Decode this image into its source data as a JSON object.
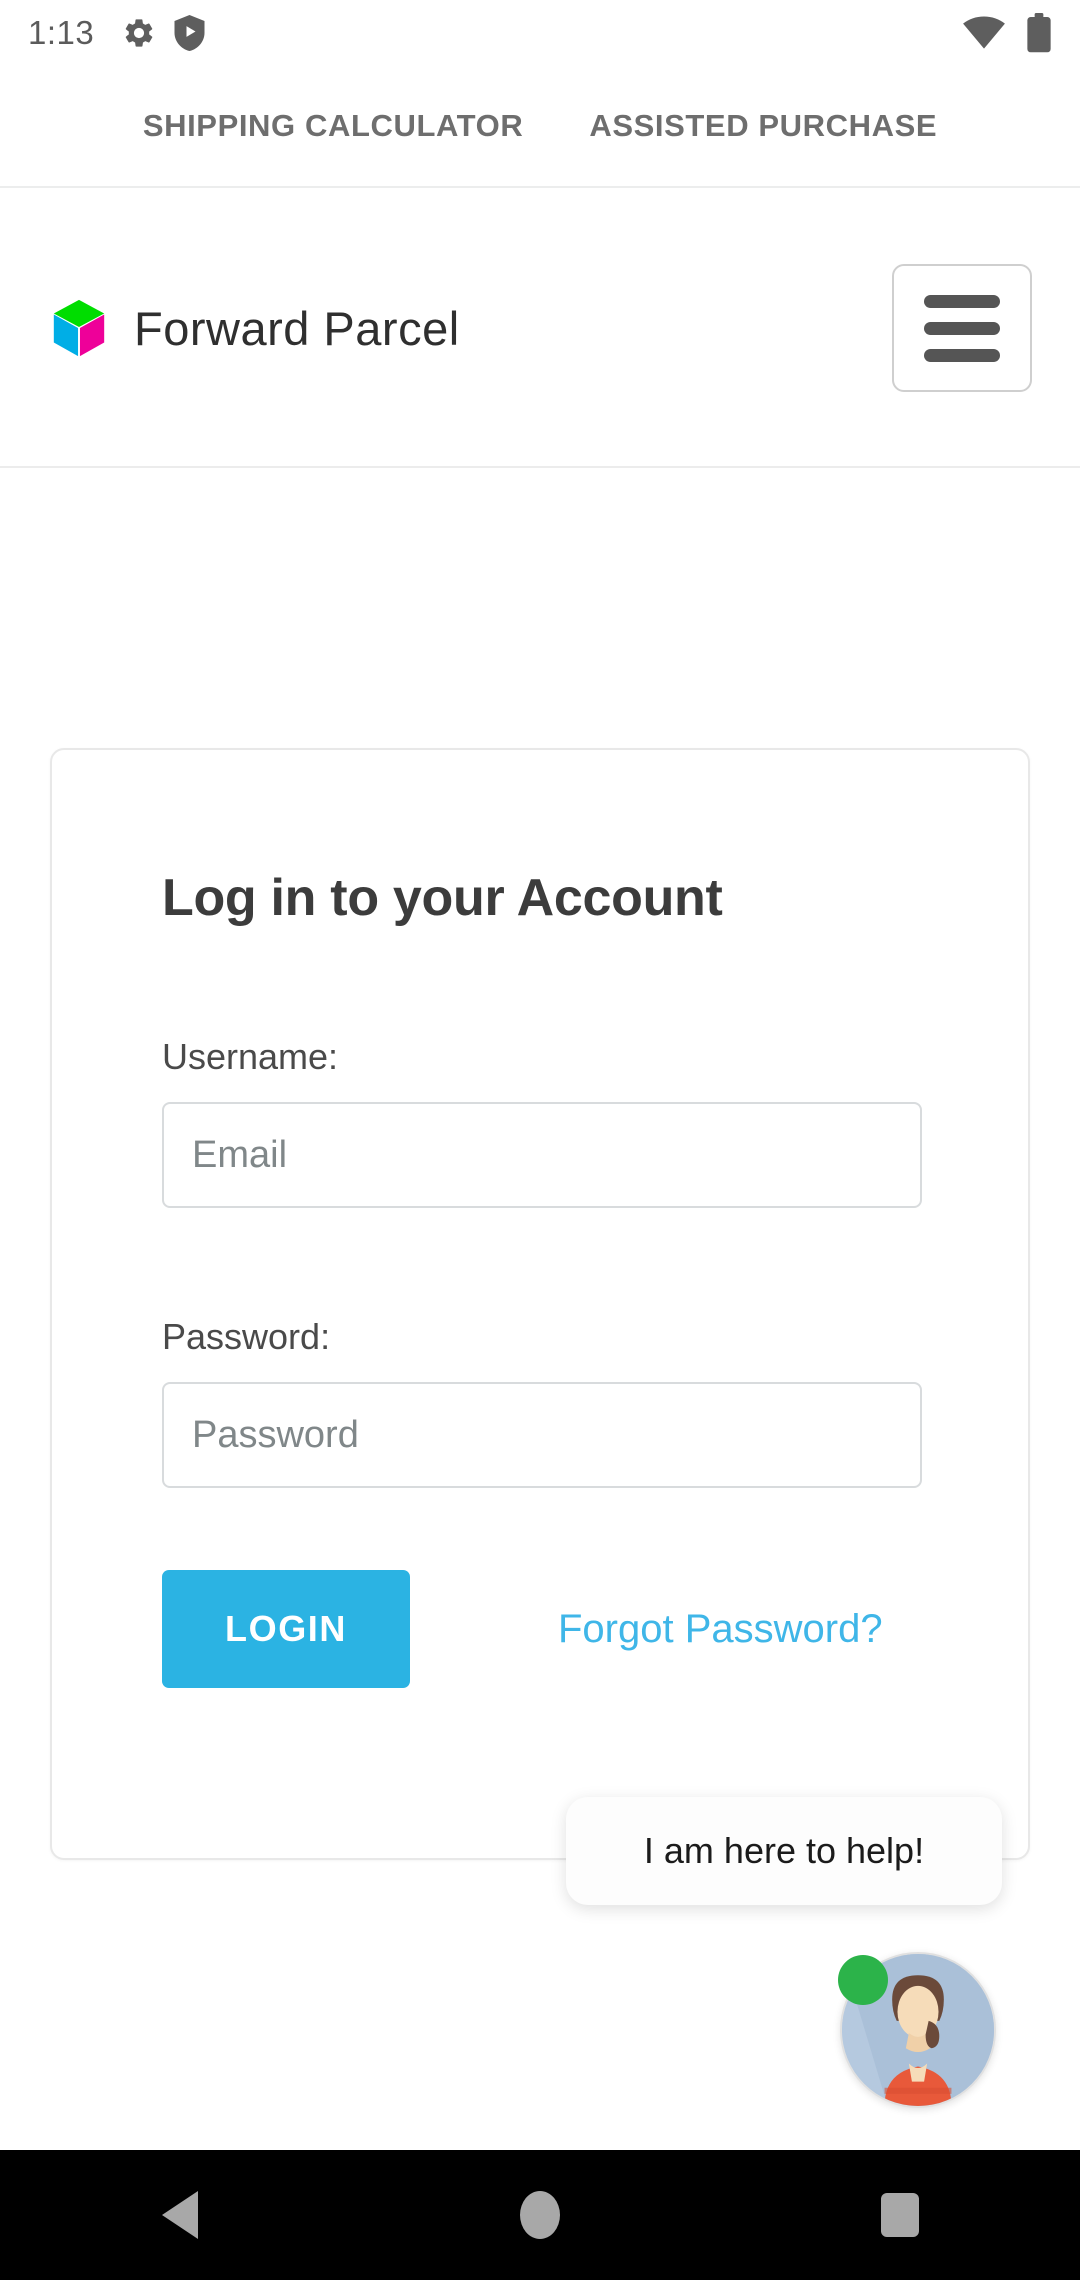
{
  "status_bar": {
    "clock": "1:13",
    "left_icons": [
      "gear-icon",
      "play-protect-shield-icon"
    ],
    "right_icons": [
      "wifi-icon",
      "battery-icon"
    ]
  },
  "tabs": [
    {
      "label": "SHIPPING CALCULATOR"
    },
    {
      "label": "ASSISTED PURCHASE"
    }
  ],
  "header": {
    "brand_name": "Forward Parcel",
    "logo_colors": {
      "top": "#00DD00",
      "left": "#00AEE6",
      "right": "#EE0099"
    },
    "menu_icon": "hamburger-menu-icon"
  },
  "login_card": {
    "title": "Log in to your Account",
    "username": {
      "label": "Username:",
      "placeholder": "Email",
      "value": ""
    },
    "password": {
      "label": "Password:",
      "placeholder": "Password",
      "value": ""
    },
    "login_button": "LOGIN",
    "forgot_link": "Forgot Password?",
    "accent_color": "#2bb3e3",
    "link_color": "#3fb6e8"
  },
  "chat_widget": {
    "message": "I am here to help!",
    "status_color": "#2cb34a",
    "avatar": "support-agent-avatar"
  },
  "nav_bar": {
    "back": "back-button",
    "home": "home-button",
    "recents": "recents-button"
  }
}
